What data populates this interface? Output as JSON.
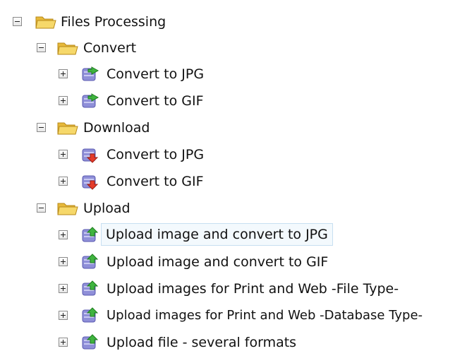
{
  "tree": {
    "root": {
      "label": "Files Processing",
      "state": "expanded",
      "icon": "folder-open-icon",
      "groups": [
        {
          "label": "Convert",
          "state": "expanded",
          "icon": "folder-open-icon",
          "items": [
            {
              "label": "Convert to JPG",
              "icon": "database-convert-icon",
              "state": "collapsed"
            },
            {
              "label": "Convert to GIF",
              "icon": "database-convert-icon",
              "state": "collapsed"
            }
          ]
        },
        {
          "label": "Download",
          "state": "expanded",
          "icon": "folder-open-icon",
          "items": [
            {
              "label": "Convert to JPG",
              "icon": "database-download-icon",
              "state": "collapsed"
            },
            {
              "label": "Convert to GIF",
              "icon": "database-download-icon",
              "state": "collapsed"
            }
          ]
        },
        {
          "label": "Upload",
          "state": "expanded",
          "icon": "folder-open-icon",
          "items": [
            {
              "label": "Upload image and convert to JPG",
              "icon": "database-upload-icon",
              "state": "collapsed",
              "selected": true
            },
            {
              "label": "Upload image and convert to GIF",
              "icon": "database-upload-icon",
              "state": "collapsed"
            },
            {
              "label": "Upload images for Print and Web -File Type-",
              "icon": "database-upload-icon",
              "state": "collapsed"
            },
            {
              "label": "Upload images for Print and Web -Database Type-",
              "icon": "database-upload-icon",
              "state": "collapsed"
            },
            {
              "label": "Upload file - several formats",
              "icon": "database-upload-icon",
              "state": "collapsed"
            }
          ]
        }
      ]
    }
  },
  "colors": {
    "folder": "#f2cc4a",
    "database": "#8f8fd8",
    "arrow_convert": "#3fb43f",
    "arrow_download": "#e53b2a",
    "arrow_upload": "#3fb43f",
    "selection_border": "#c7dff1",
    "selection_fill": "#f3f9fd"
  }
}
